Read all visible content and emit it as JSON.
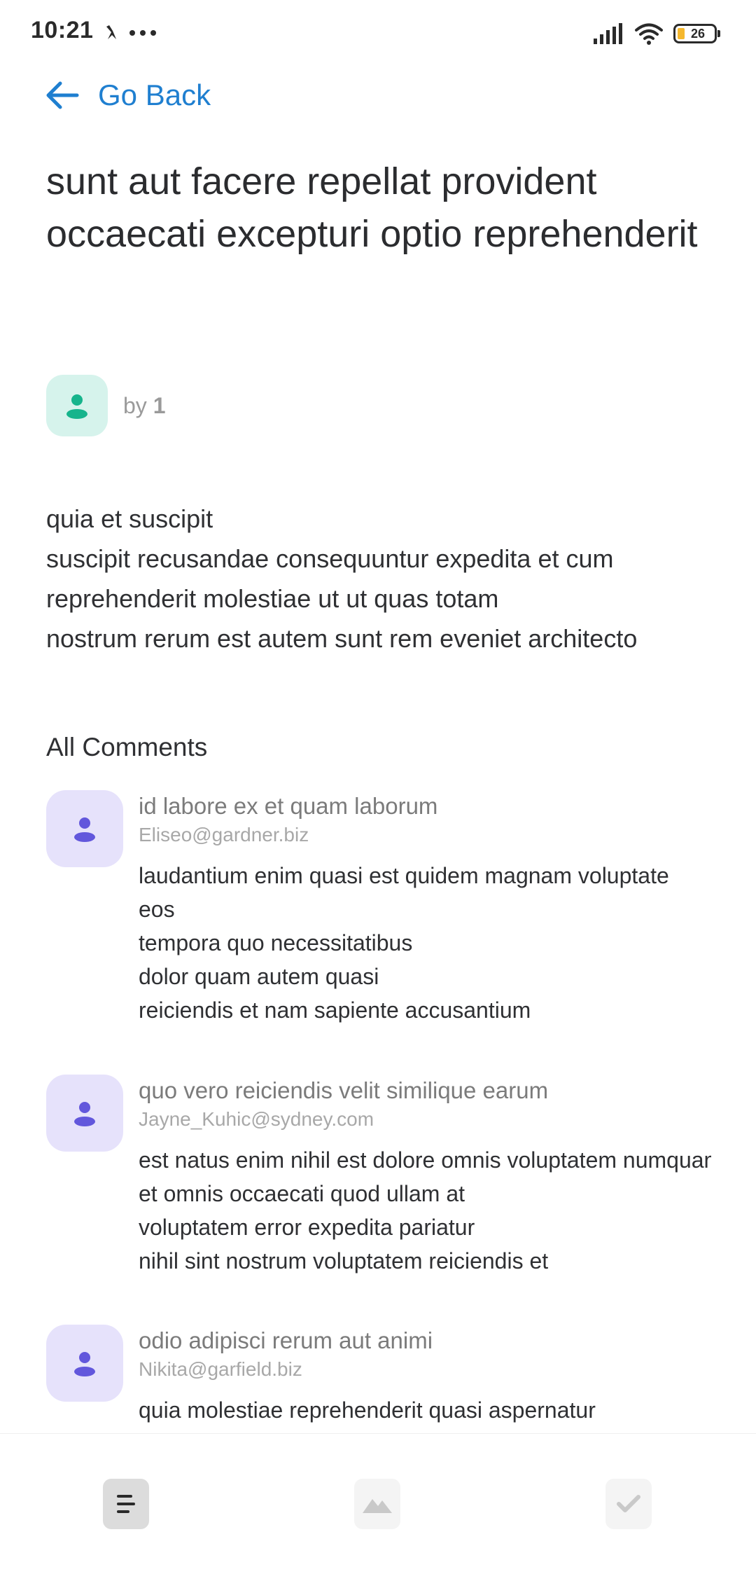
{
  "status_bar": {
    "time": "10:21",
    "battery": "26"
  },
  "nav": {
    "back_label": "Go Back"
  },
  "post": {
    "title": "sunt aut facere repellat provident occaecati excepturi optio reprehenderit",
    "author_prefix": "by",
    "author": "1",
    "body_lines": [
      "quia et suscipit",
      "suscipit recusandae consequuntur expedita et cum",
      "reprehenderit molestiae ut ut quas totam",
      "nostrum rerum est autem sunt rem eveniet architecto"
    ]
  },
  "comments_heading": "All Comments",
  "comments": [
    {
      "name": "id labore ex et quam laborum",
      "email": "Eliseo@gardner.biz",
      "body_lines": [
        "laudantium enim quasi est quidem magnam voluptate",
        "eos",
        "tempora quo necessitatibus",
        "dolor quam autem quasi",
        "reiciendis et nam sapiente accusantium"
      ]
    },
    {
      "name": "quo vero reiciendis velit similique earum",
      "email": "Jayne_Kuhic@sydney.com",
      "body_lines": [
        "est natus enim nihil est dolore omnis voluptatem numquam",
        "et omnis occaecati quod ullam at",
        "voluptatem error expedita pariatur",
        "nihil sint nostrum voluptatem reiciendis et"
      ]
    },
    {
      "name": "odio adipisci rerum aut animi",
      "email": "Nikita@garfield.biz",
      "body_lines": [
        "quia molestiae reprehenderit quasi aspernatur"
      ]
    }
  ],
  "bottom_nav": {
    "items": [
      {
        "icon": "menu-icon",
        "active": true
      },
      {
        "icon": "image-icon",
        "active": false
      },
      {
        "icon": "check-icon",
        "active": false
      }
    ]
  },
  "colors": {
    "accent": "#1f7fd0",
    "author_avatar_bg": "#d6f3ec",
    "author_avatar_icon": "#16b48c",
    "comment_avatar_bg": "#e6e2fb",
    "comment_avatar_icon": "#6257dc"
  }
}
